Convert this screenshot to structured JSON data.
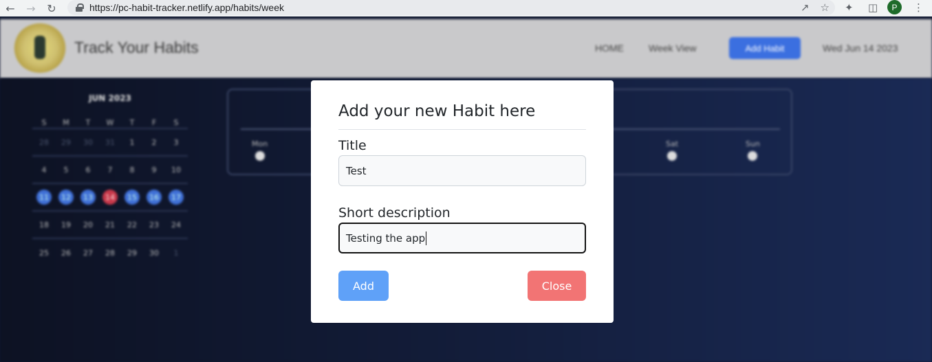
{
  "browser": {
    "url": "https://pc-habit-tracker.netlify.app/habits/week",
    "profile_initial": "P"
  },
  "header": {
    "app_title": "Track Your Habits",
    "nav": {
      "home": "HOME",
      "week_view": "Week View",
      "add_habit": "Add Habit",
      "date": "Wed Jun 14 2023"
    }
  },
  "calendar": {
    "month_label": "JUN 2023",
    "weekdays": [
      "S",
      "M",
      "T",
      "W",
      "T",
      "F",
      "S"
    ],
    "weeks": [
      [
        "28",
        "29",
        "30",
        "31",
        "1",
        "2",
        "3"
      ],
      [
        "4",
        "5",
        "6",
        "7",
        "8",
        "9",
        "10"
      ],
      [
        "11",
        "12",
        "13",
        "14",
        "15",
        "16",
        "17"
      ],
      [
        "18",
        "19",
        "20",
        "21",
        "22",
        "23",
        "24"
      ],
      [
        "25",
        "26",
        "27",
        "28",
        "29",
        "30",
        "1"
      ]
    ]
  },
  "week_card": {
    "days": [
      "Mon",
      "Sat",
      "Sun"
    ]
  },
  "modal": {
    "title": "Add your new Habit here",
    "title_label": "Title",
    "title_value": "Test",
    "description_label": "Short description",
    "description_value": "Testing the app",
    "add_button": "Add",
    "close_button": "Close"
  },
  "colors": {
    "add_button": "#5fa1f8",
    "close_button": "#f27474",
    "nav_button": "#3b6fe0",
    "highlight_today": "#c7384a",
    "week_highlight": "#3f6fd6"
  }
}
